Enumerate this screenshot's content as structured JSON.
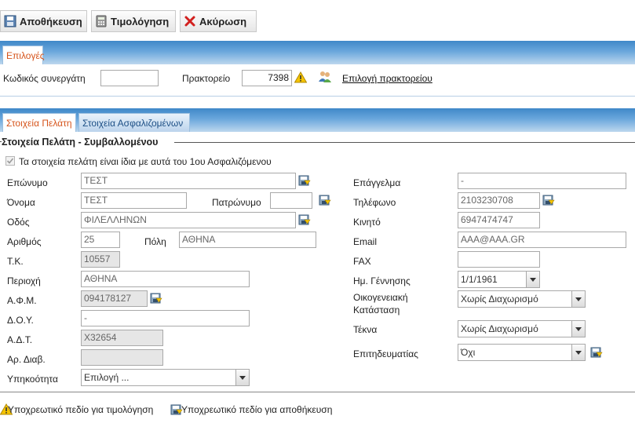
{
  "toolbar": {
    "save_label": "Αποθήκευση",
    "invoice_label": "Τιμολόγηση",
    "cancel_label": "Ακύρωση"
  },
  "options": {
    "tab_label": "Επιλογές",
    "partner_code_label": "Κωδικός συνεργάτη",
    "partner_code_value": "",
    "agency_label": "Πρακτορείο",
    "agency_value": "7398",
    "agency_link": "Επιλογή πρακτορείου"
  },
  "tabs": {
    "client": "Στοιχεία Πελάτη",
    "insured": "Στοιχεία Ασφαλιζομένων"
  },
  "client": {
    "section_title": "Στοιχεία Πελάτη - Συμβαλλομένου",
    "same_as_insured_label": "Τα στοιχεία πελάτη είναι ίδια με αυτά του 1ου Ασφαλιζόμενου",
    "surname_label": "Επώνυμο",
    "surname_value": "ΤΕΣΤ",
    "name_label": "Όνομα",
    "name_value": "ΤΕΣΤ",
    "father_label": "Πατρώνυμο",
    "father_value": "",
    "street_label": "Οδός",
    "street_value": "ΦΙΛΕΛΛΗΝΩΝ",
    "number_label": "Αριθμός",
    "number_value": "25",
    "city_label": "Πόλη",
    "city_value": "ΑΘΗΝΑ",
    "zip_label": "Τ.Κ.",
    "zip_value": "10557",
    "area_label": "Περιοχή",
    "area_value": "ΑΘΗΝΑ",
    "afm_label": "Α.Φ.Μ.",
    "afm_value": "094178127",
    "doy_label": "Δ.Ο.Υ.",
    "doy_value": "-",
    "adt_label": "Α.Δ.Τ.",
    "adt_value": "Χ32654",
    "passport_label": "Αρ. Διαβ.",
    "passport_value": "",
    "citizenship_label": "Υπηκοότητα",
    "citizenship_value": "Επιλογή ...",
    "profession_label": "Επάγγελμα",
    "profession_value": "-",
    "phone_label": "Τηλέφωνο",
    "phone_value": "2103230708",
    "mobile_label": "Κινητό",
    "mobile_value": "6947474747",
    "email_label": "Email",
    "email_value": "AAA@AAA.GR",
    "fax_label": "FAX",
    "fax_value": "",
    "birth_label": "Ημ. Γέννησης",
    "birth_value": "1/1/1961",
    "marital_label_1": "Οικογενειακή",
    "marital_label_2": "Κατάσταση",
    "marital_value": "Χωρίς Διαχωρισμό",
    "children_label": "Τέκνα",
    "children_value": "Χωρίς Διαχωρισμό",
    "professional_label": "Επιτηδευματίας",
    "professional_value": "Όχι"
  },
  "legend": {
    "invoice_required": "Υποχρεωτικό πεδίο για τιμολόγηση",
    "save_required": "Υποχρεωτικό πεδίο για αποθήκευση"
  },
  "colors": {
    "active_tab_text": "#d6541b",
    "bar_blue": "#3f88c8",
    "warning_yellow": "#f5c400"
  }
}
